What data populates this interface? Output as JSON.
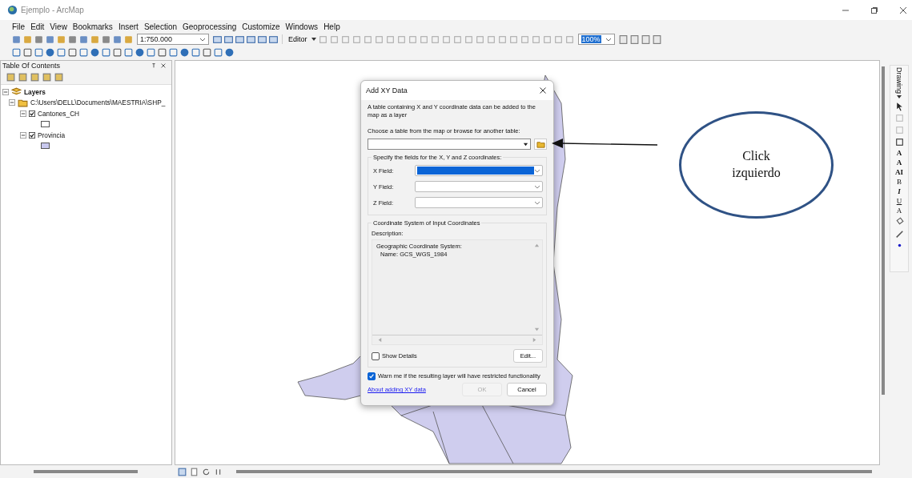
{
  "window": {
    "title": "Ejemplo - ArcMap"
  },
  "menu": [
    "File",
    "Edit",
    "View",
    "Bookmarks",
    "Insert",
    "Selection",
    "Geoprocessing",
    "Customize",
    "Windows",
    "Help"
  ],
  "toolbar": {
    "scale": "1:750.000",
    "editor": "Editor",
    "zoom": "100%"
  },
  "toc": {
    "title": "Table Of Contents",
    "root": {
      "label": "Layers",
      "expanded": true,
      "children": [
        {
          "label": "C:\\Users\\DELL\\Documents\\MAESTRIA\\SHP_",
          "expanded": true,
          "children": [
            {
              "label": "Cantones_CH",
              "checked": true,
              "expanded": true,
              "color": "#ffffff"
            },
            {
              "label": "Provincia",
              "checked": true,
              "expanded": true,
              "color": "#c8c8ee"
            }
          ]
        }
      ]
    }
  },
  "drawing_toolbar": {
    "title": "Drawing",
    "letters": [
      "A",
      "A",
      "AI",
      "B",
      "I",
      "U",
      "A"
    ]
  },
  "dialog": {
    "title": "Add XY Data",
    "intro": "A table containing X and Y coordinate data can be added to the map as a layer",
    "choose_label": "Choose a table from the map or browse for another table:",
    "fields_group": "Specify the fields for the X, Y and Z coordinates:",
    "fields": [
      {
        "label": "X Field:",
        "selected": true
      },
      {
        "label": "Y Field:",
        "selected": false
      },
      {
        "label": "Z Field:",
        "selected": false
      }
    ],
    "coord_group": "Coordinate System of Input Coordinates",
    "description_label": "Description:",
    "description": [
      "Geographic Coordinate System:",
      "Name: GCS_WGS_1984"
    ],
    "show_details": {
      "label": "Show Details",
      "checked": false
    },
    "edit_button": "Edit...",
    "warn": {
      "label": "Warn me if the resulting layer will have restricted functionality",
      "checked": true
    },
    "link": "About adding XY data",
    "ok": {
      "label": "OK",
      "disabled": true
    },
    "cancel": "Cancel"
  },
  "annotation": {
    "text": "Click izquierdo"
  }
}
